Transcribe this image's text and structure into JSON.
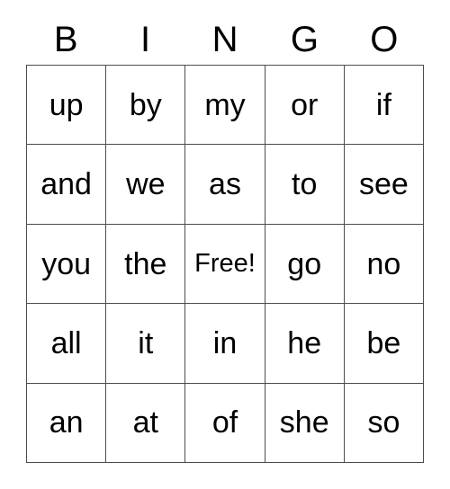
{
  "card": {
    "title": "BINGO",
    "header_letters": [
      "B",
      "I",
      "N",
      "G",
      "O"
    ],
    "free_space_label": "Free!",
    "free_space_position": {
      "row": 2,
      "col": 2
    },
    "colors": {
      "background": "#ffffff",
      "text": "#000000",
      "grid_line": "#4d4d4d"
    },
    "grid": [
      [
        "up",
        "by",
        "my",
        "or",
        "if"
      ],
      [
        "and",
        "we",
        "as",
        "to",
        "see"
      ],
      [
        "you",
        "the",
        "Free!",
        "go",
        "no"
      ],
      [
        "all",
        "it",
        "in",
        "he",
        "be"
      ],
      [
        "an",
        "at",
        "of",
        "she",
        "so"
      ]
    ]
  }
}
